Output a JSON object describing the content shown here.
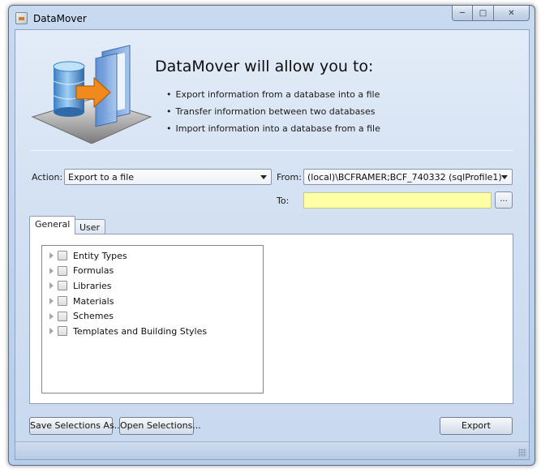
{
  "window": {
    "title": "DataMover"
  },
  "hero": {
    "headline": "DataMover will allow you to:",
    "bullets": [
      "Export information from a database into a file",
      "Transfer information between two databases",
      "Import information into a database from a file"
    ]
  },
  "form": {
    "action_label": "Action:",
    "action_value": "Export to a file",
    "from_label": "From:",
    "from_value": "(local)\\BCFRAMER;BCF_740332 (sqlProfile1)",
    "to_label": "To:",
    "to_value": "",
    "browse_label": "..."
  },
  "tabs": [
    {
      "label": "General",
      "active": true
    },
    {
      "label": "User",
      "active": false
    }
  ],
  "tree": {
    "items": [
      {
        "label": "Entity Types",
        "checked": false
      },
      {
        "label": "Formulas",
        "checked": false
      },
      {
        "label": "Libraries",
        "checked": false
      },
      {
        "label": "Materials",
        "checked": false
      },
      {
        "label": "Schemes",
        "checked": false
      },
      {
        "label": "Templates and Building Styles",
        "checked": false
      }
    ]
  },
  "buttons": {
    "save_selections": "Save Selections As...",
    "open_selections": "Open Selections...",
    "export": "Export"
  },
  "colors": {
    "to_field_bg": "#ffffa6",
    "client_bg": "#d2e0f2"
  }
}
